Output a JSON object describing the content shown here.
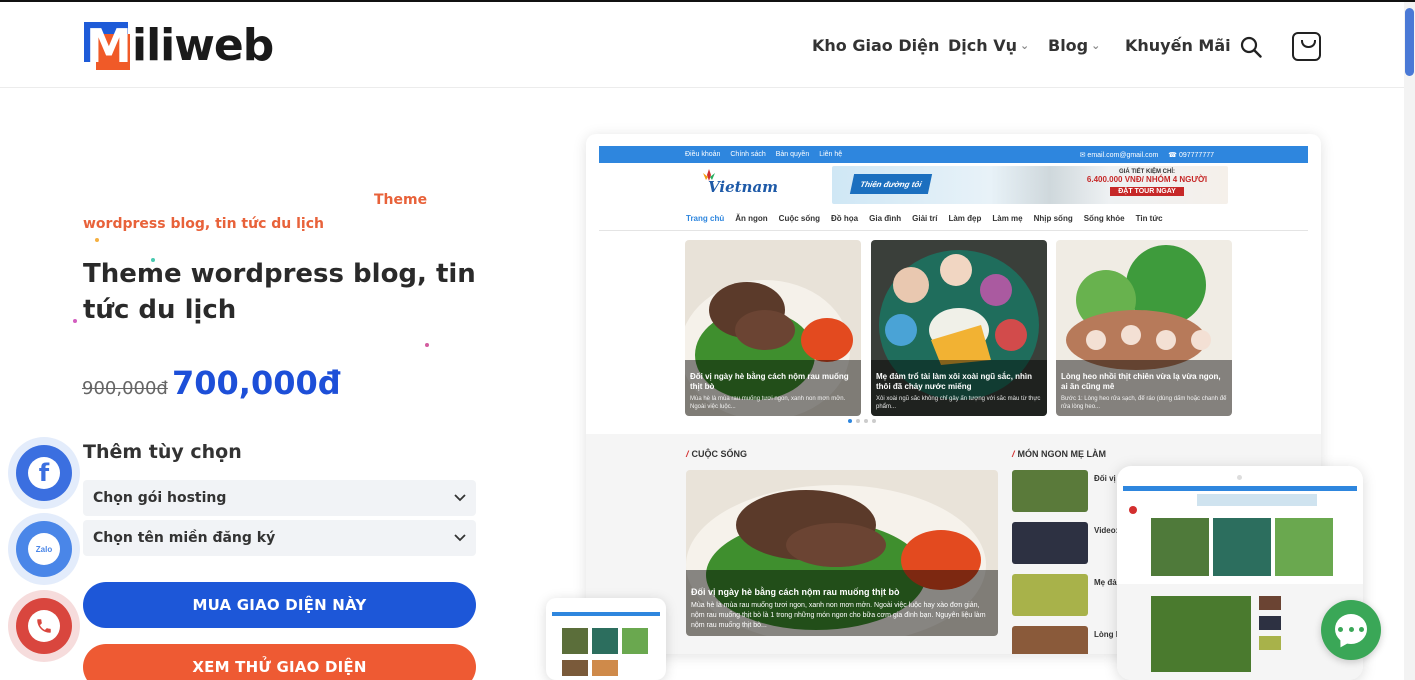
{
  "header": {
    "logo_text": "iliweb",
    "logo_mark": "M",
    "nav": [
      {
        "label": "Kho Giao Diện",
        "has_dropdown": false
      },
      {
        "label": "Dịch Vụ",
        "has_dropdown": true
      },
      {
        "label": "Blog",
        "has_dropdown": true
      },
      {
        "label": "Khuyến Mãi",
        "has_dropdown": false
      }
    ],
    "search_icon": "search-icon",
    "cart_icon": "cart-icon"
  },
  "product": {
    "tag": "Theme",
    "category": "wordpress blog, tin tức du lịch",
    "title": "Theme wordpress blog, tin tức du lịch",
    "old_price": "900,000đ",
    "new_price": "700,000đ",
    "options_label": "Thêm tùy chọn",
    "select_hosting": "Chọn gói hosting",
    "select_domain": "Chọn tên miền đăng ký",
    "buy_button": "MUA GIAO DIỆN NÀY",
    "demo_button": "XEM THỬ GIAO DIỆN"
  },
  "floating": {
    "facebook": "f",
    "zalo": "Zalo"
  },
  "mockup": {
    "topbar_links": [
      "Điều khoản",
      "Chính sách",
      "Bản quyền",
      "Liên hệ"
    ],
    "topbar_email": "✉ email.com@gmail.com",
    "topbar_phone": "☎ 097777777",
    "site_logo": "Vietnam",
    "banner_left": "Thiên đường tôi",
    "banner_right_line1": "GIÁ TIẾT KIỆM CHỈ:",
    "banner_right_line2": "6.400.000 VNĐ/ NHÓM 4 NGƯỜI",
    "banner_right_cta": "ĐẶT TOUR NGAY",
    "nav": [
      "Trang chủ",
      "Ăn ngon",
      "Cuộc sống",
      "Đồ họa",
      "Gia đình",
      "Giải trí",
      "Làm đẹp",
      "Làm mẹ",
      "Nhịp sống",
      "Sống khỏe",
      "Tin tức"
    ],
    "cards": [
      {
        "title": "Đối vị ngày hè bằng cách nộm rau muống thịt bò",
        "excerpt": "Mùa hè là mùa rau muống tươi ngon, xanh non mơn mởn. Ngoài việc luộc..."
      },
      {
        "title": "Mẹ đảm trổ tài làm xôi xoài ngũ sắc, nhìn thôi đã chảy nước miếng",
        "excerpt": "Xôi xoài ngũ sắc không chỉ gây ấn tượng với sắc màu từ thực phẩm..."
      },
      {
        "title": "Lòng heo nhồi thịt chiên vừa lạ vừa ngon, ai ăn cũng mê",
        "excerpt": "Bước 1: Lòng heo rửa sạch, để ráo (dùng dấm hoặc chanh để rửa lòng heo..."
      }
    ],
    "section_left": "CUỘC SỐNG",
    "section_right": "MÓN NGON MẸ LÀM",
    "big_title": "Đối vị ngày hè bằng cách nộm rau muống thịt bò",
    "big_excerpt": "Mùa hè là mùa rau muống tươi ngon, xanh non mơn mởn. Ngoài việc luộc hay xào đơn giản, nộm rau muống thịt bò là 1 trong những món ngon cho bữa cơm gia đình bạn. Nguyên liệu làm nộm rau muống thịt bò...",
    "side_items": [
      "Đối vị",
      "Video:",
      "Mẹ đả",
      "Lòng h"
    ]
  }
}
